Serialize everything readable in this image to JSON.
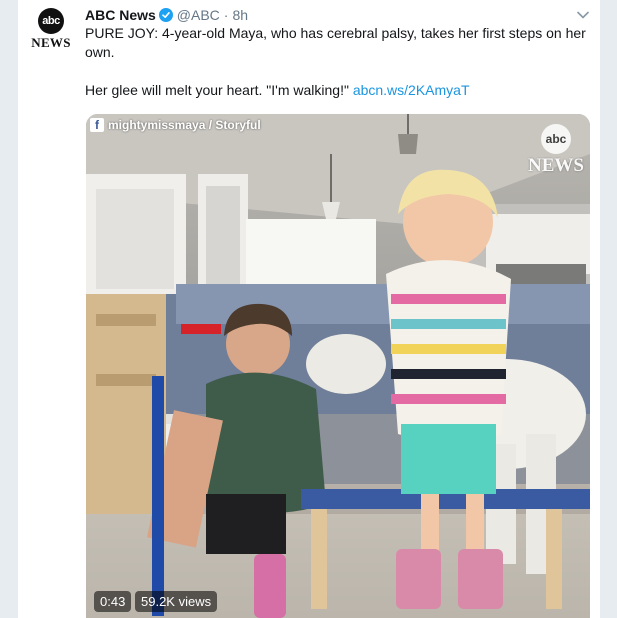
{
  "tweet": {
    "name": "ABC News",
    "handle": "@ABC",
    "separator": "·",
    "time": "8h",
    "avatar": {
      "logo_text": "abc",
      "news_text": "NEWS"
    },
    "text_line1": "PURE JOY: 4-year-old Maya, who has cerebral palsy, takes her first steps on her own.",
    "text_line2": "Her glee will melt your heart. \"I'm walking!\"",
    "link": "abcn.ws/2KAmyaT"
  },
  "video": {
    "credit": "mightymissmaya / Storyful",
    "credit_icon": "f",
    "watermark_logo": "abc",
    "watermark_news": "NEWS",
    "duration": "0:43",
    "views": "59.2K views"
  },
  "colors": {
    "background": "#e6ecf0",
    "link": "#1b95e0",
    "verified": "#1da1f2",
    "muted": "#657786"
  },
  "icons": [
    "verified-badge-icon",
    "chevron-down-icon",
    "facebook-icon"
  ]
}
